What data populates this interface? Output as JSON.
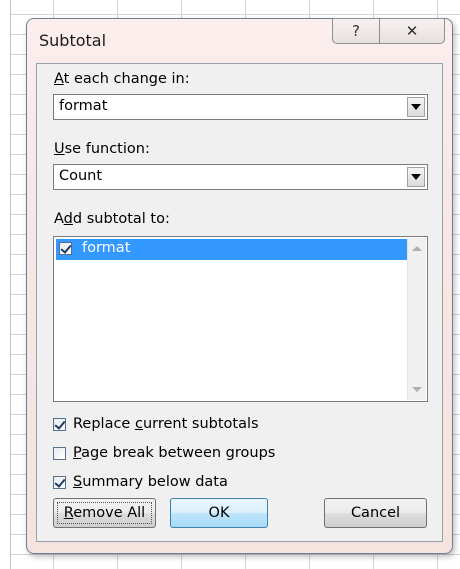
{
  "dialog": {
    "title": "Subtotal",
    "help_glyph": "?",
    "close_glyph": "✕"
  },
  "change_in": {
    "label_u": "A",
    "label_rest": "t each change in:",
    "value": "format"
  },
  "use_function": {
    "label_u": "U",
    "label_rest": "se function:",
    "value": "Count"
  },
  "add_subtotal": {
    "label_pre": "A",
    "label_u": "d",
    "label_rest": "d subtotal to:",
    "items": [
      {
        "label": "format",
        "checked": true,
        "selected": true
      }
    ]
  },
  "options": {
    "replace": {
      "pre": "Replace ",
      "u": "c",
      "rest": "urrent subtotals",
      "checked": true
    },
    "page_break": {
      "pre": "",
      "u": "P",
      "rest": "age break between groups",
      "checked": false
    },
    "summary": {
      "pre": "",
      "u": "S",
      "rest": "ummary below data",
      "checked": true
    }
  },
  "buttons": {
    "remove_u": "R",
    "remove_rest": "emove All",
    "ok": "OK",
    "cancel": "Cancel"
  },
  "colors": {
    "selection": "#3399ff",
    "dialog_frame": "#f6e3e0"
  },
  "icons": [
    "help-icon",
    "close-icon",
    "dropdown-arrow-icon",
    "checkbox-icon"
  ]
}
